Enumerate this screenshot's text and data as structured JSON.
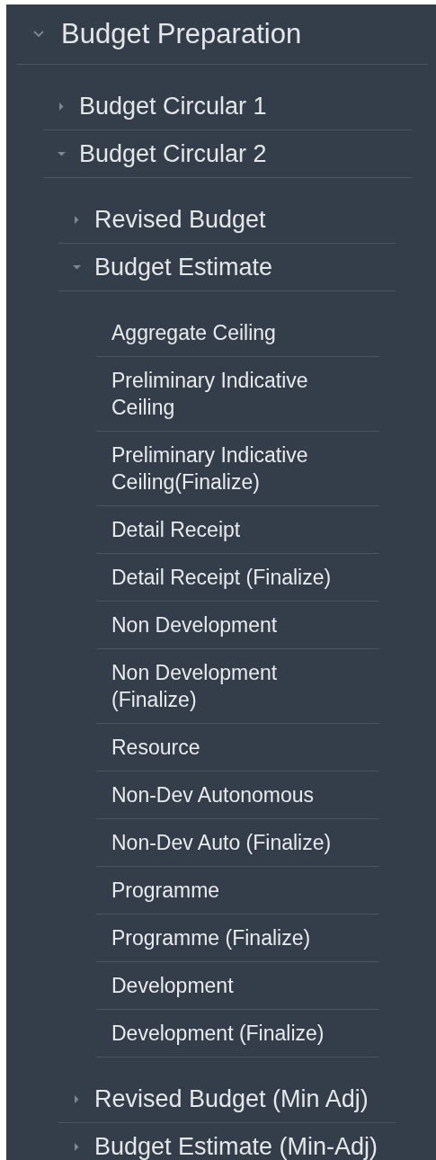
{
  "menu": [
    {
      "label": "Budget Preparation",
      "expanded": true,
      "children": [
        {
          "label": "Budget Circular 1",
          "expanded": false
        },
        {
          "label": "Budget Circular 2",
          "expanded": true,
          "children": [
            {
              "label": "Revised Budget",
              "expanded": false
            },
            {
              "label": "Budget Estimate",
              "expanded": true,
              "children": [
                {
                  "label": "Aggregate Ceiling"
                },
                {
                  "label": "Preliminary Indicative Ceiling"
                },
                {
                  "label": "Preliminary Indicative Ceiling(Finalize)"
                },
                {
                  "label": "Detail Receipt"
                },
                {
                  "label": "Detail Receipt (Finalize)"
                },
                {
                  "label": "Non Development"
                },
                {
                  "label": "Non Development (Finalize)"
                },
                {
                  "label": "Resource"
                },
                {
                  "label": "Non-Dev Autonomous"
                },
                {
                  "label": "Non-Dev Auto (Finalize)"
                },
                {
                  "label": "Programme"
                },
                {
                  "label": "Programme (Finalize)"
                },
                {
                  "label": "Development"
                },
                {
                  "label": "Development (Finalize)"
                }
              ]
            },
            {
              "label": "Revised Budget (Min Adj)",
              "expanded": false
            },
            {
              "label": "Budget Estimate (Min-Adj)",
              "expanded": false
            }
          ]
        }
      ]
    }
  ]
}
